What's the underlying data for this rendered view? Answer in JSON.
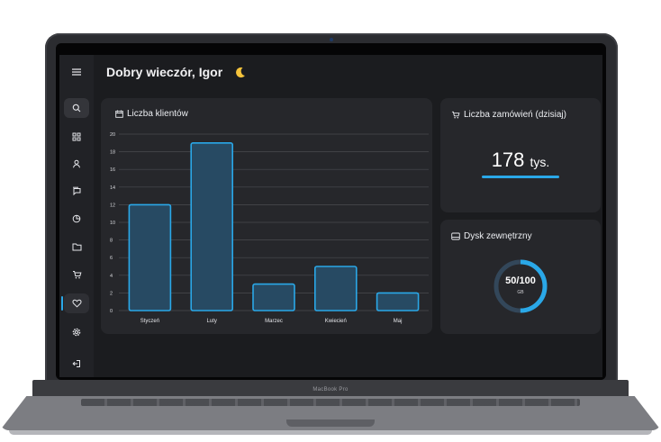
{
  "device": {
    "brand_label": "MacBook Pro"
  },
  "header": {
    "greeting": "Dobry wieczór, Igor",
    "greeting_icon": "moon-icon"
  },
  "sidebar": {
    "items": [
      {
        "icon": "menu-icon"
      },
      {
        "icon": "search-icon",
        "active": true
      },
      {
        "icon": "grid-icon"
      },
      {
        "icon": "user-icon"
      },
      {
        "icon": "chat-icon"
      },
      {
        "icon": "pie-chart-icon"
      },
      {
        "icon": "folder-icon"
      },
      {
        "icon": "cart-icon"
      },
      {
        "icon": "heart-icon",
        "selected": true
      },
      {
        "icon": "settings-icon"
      },
      {
        "icon": "logout-icon"
      }
    ],
    "accent": "#2aa8e8"
  },
  "clients_card": {
    "title": "Liczba klientów",
    "icon": "calendar-icon"
  },
  "orders_card": {
    "title": "Liczba zamówień (dzisiaj)",
    "icon": "cart-icon",
    "value": "178",
    "unit": "tys."
  },
  "disk_card": {
    "title": "Dysk zewnętrzny",
    "icon": "drive-icon",
    "used": 50,
    "total": 100,
    "value_label": "50/100",
    "unit": "GB"
  },
  "chart_data": {
    "type": "bar",
    "categories": [
      "Styczeń",
      "Luty",
      "Marzec",
      "Kwiecień",
      "Maj"
    ],
    "values": [
      12,
      19,
      3,
      5,
      2
    ],
    "ylim": [
      0,
      20
    ],
    "yticks": [
      0,
      2,
      4,
      6,
      8,
      10,
      12,
      14,
      16,
      18,
      20
    ],
    "grid": true,
    "title": "Liczba klientów",
    "bar_fill": "#274a63",
    "bar_stroke": "#2aa8e8"
  },
  "colors": {
    "background": "#1b1c1f",
    "card": "#26272b",
    "accent": "#2aa8e8"
  }
}
